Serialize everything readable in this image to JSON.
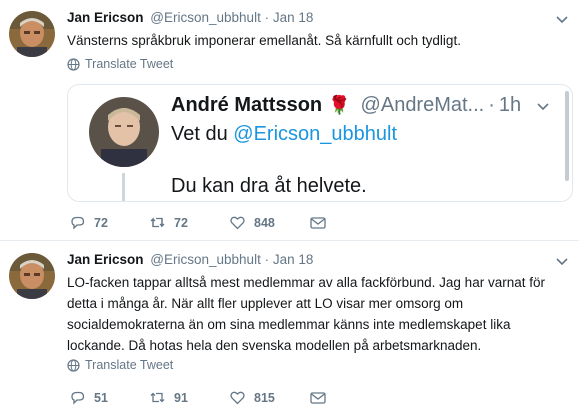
{
  "tweets": [
    {
      "author_name": "Jan Ericson",
      "author_handle": "@Ericson_ubbhult",
      "separator": "·",
      "time": "Jan 18",
      "text": "Vänsterns språkbruk imponerar emellanåt. Så kärnfullt och tydligt.",
      "translate_label": "Translate Tweet",
      "replies": "72",
      "retweets": "72",
      "likes": "848",
      "quote": {
        "author_name": "André Mattsson",
        "author_handle": "@AndreMat...",
        "separator": "·",
        "time": "1h",
        "line1_prefix": "Vet du ",
        "line1_mention": "@Ericson_ubbhult",
        "line2": "Du kan dra åt helvete."
      }
    },
    {
      "author_name": "Jan Ericson",
      "author_handle": "@Ericson_ubbhult",
      "separator": "·",
      "time": "Jan 18",
      "text_lines": [
        "LO-facken tappar alltså mest medlemmar av alla fackförbund. Jag har varnat för",
        "detta i många år. När allt fler upplever att LO visar mer omsorg om",
        "socialdemokraterna än om sina medlemmar känns inte medlemskapet lika",
        "lockande. Då hotas hela den svenska modellen på arbetsmarknaden."
      ],
      "translate_label": "Translate Tweet",
      "replies": "51",
      "retweets": "91",
      "likes": "815"
    }
  ],
  "colors": {
    "text": "#14171a",
    "secondary": "#657786",
    "link": "#1b95e0",
    "rose": "#d0021b",
    "border": "#e6ecf0"
  },
  "icons": [
    "chevron-down-icon",
    "globe-icon",
    "reply-icon",
    "retweet-icon",
    "heart-icon",
    "envelope-icon",
    "rose-icon"
  ]
}
